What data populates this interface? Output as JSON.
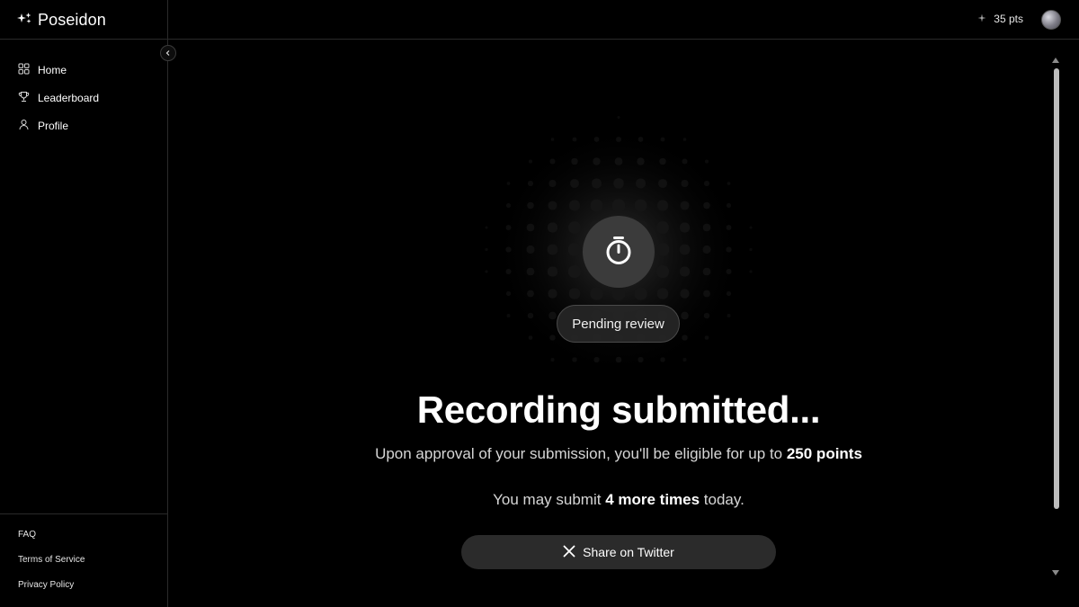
{
  "brand": {
    "name": "Poseidon",
    "icon": "sparkles-icon"
  },
  "sidebar": {
    "items": [
      {
        "label": "Home",
        "icon": "grid-icon"
      },
      {
        "label": "Leaderboard",
        "icon": "trophy-icon"
      },
      {
        "label": "Profile",
        "icon": "user-icon"
      }
    ],
    "footer": [
      "FAQ",
      "Terms of Service",
      "Privacy Policy"
    ]
  },
  "header": {
    "points": "35 pts",
    "points_icon": "sparkle-icon"
  },
  "status": {
    "icon": "stopwatch-icon",
    "badge": "Pending review",
    "title": "Recording submitted...",
    "subtitle_prefix": "Upon approval of your submission, you'll be eligible for up to ",
    "subtitle_points": "250 points",
    "remaining_prefix": "You may submit ",
    "remaining_count": "4 more times",
    "remaining_suffix": " today."
  },
  "share": {
    "label": "Share on Twitter",
    "icon": "x-logo-icon"
  },
  "colors": {
    "background": "#000000",
    "button": "#2b2b2b",
    "circle": "#3b3b3b"
  }
}
